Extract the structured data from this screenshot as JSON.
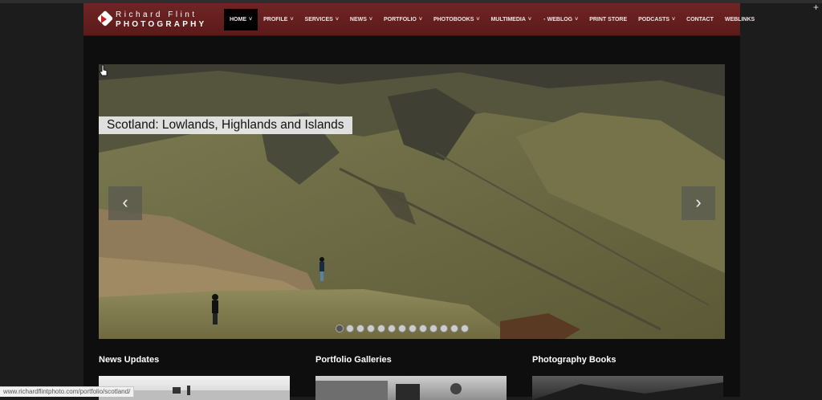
{
  "logo": {
    "line1": "Richard Flint",
    "line2": "PHOTOGRAPHY"
  },
  "nav": [
    {
      "label": "HOME",
      "dropdown": true,
      "active": true
    },
    {
      "label": "PROFILE",
      "dropdown": true
    },
    {
      "label": "SERVICES",
      "dropdown": true
    },
    {
      "label": "NEWS",
      "dropdown": true
    },
    {
      "label": "PORTFOLIO",
      "dropdown": true
    },
    {
      "label": "PHOTOBOOKS",
      "dropdown": true
    },
    {
      "label": "MULTIMEDIA",
      "dropdown": true
    },
    {
      "label": "WEBLOG",
      "dropdown": true,
      "icon": "rss-icon"
    },
    {
      "label": "PRINT STORE",
      "dropdown": false
    },
    {
      "label": "PODCASTS",
      "dropdown": true
    },
    {
      "label": "CONTACT",
      "dropdown": false
    },
    {
      "label": "WEBLINKS",
      "dropdown": false
    }
  ],
  "slider": {
    "caption": "Scotland: Lowlands, Highlands and Islands",
    "prev_icon": "chevron-left-icon",
    "next_icon": "chevron-right-icon",
    "slide_count": 13,
    "active_index": 0
  },
  "sections": [
    {
      "title": "News Updates"
    },
    {
      "title": "Portfolio Galleries"
    },
    {
      "title": "Photography Books"
    }
  ],
  "status_bar": {
    "url": "www.richardflintphoto.com/portfolio/scotland/"
  },
  "colors": {
    "nav_bg": "#6f2424",
    "page_bg": "#0e0e0e",
    "outer_bg": "#1c1c1c"
  }
}
